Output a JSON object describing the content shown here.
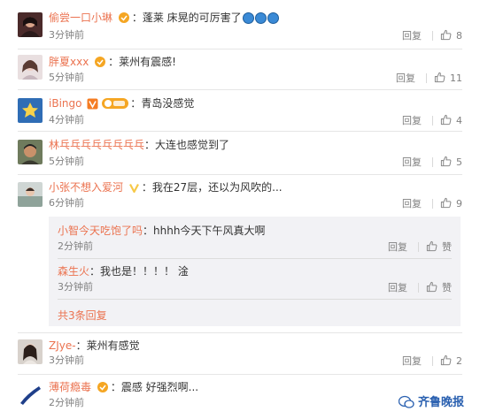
{
  "colors": {
    "username": "#eb7350",
    "text": "#333333",
    "muted": "#808080",
    "badge_orange": "#f5a623",
    "badge_yellow": "#f7c948"
  },
  "comments": [
    {
      "user": "偷尝一口小琳",
      "text": "蓬莱 床晃的可厉害了",
      "emoji_count": 3,
      "time": "3分钟前",
      "reply": "回复",
      "likes": "8"
    },
    {
      "user": "胖夏xxx",
      "text": "莱州有震感!",
      "time": "5分钟前",
      "reply": "回复",
      "likes": "11"
    },
    {
      "user": "iBingo",
      "text": "青岛没感觉",
      "time": "4分钟前",
      "reply": "回复",
      "likes": "4"
    },
    {
      "user": "林乓乓乓乓乓乓乓乓",
      "text": "大连也感觉到了",
      "time": "5分钟前",
      "reply": "回复",
      "likes": "5"
    },
    {
      "user": "小张不想入爱河",
      "text": "我在27层，还以为风吹的...",
      "time": "6分钟前",
      "reply": "回复",
      "likes": "9"
    },
    {
      "user": "ZJye-",
      "text": "莱州有感觉",
      "time": "3分钟前",
      "reply": "回复",
      "likes": "2"
    },
    {
      "user": "薄荷瘾毒",
      "text": "震感 好强烈啊...",
      "time": "2分钟前",
      "reply": "回复"
    }
  ],
  "replies": [
    {
      "user": "小智今天吃饱了吗",
      "text": "hhhh今天下午风真大啊",
      "time": "2分钟前",
      "reply": "回复",
      "like_label": "赞"
    },
    {
      "user": "森生火",
      "text": "我也是！！！！ 淦",
      "time": "3分钟前",
      "reply": "回复",
      "like_label": "赞"
    }
  ],
  "replies_total": "共3条回复",
  "watermark": "齐鲁晚报"
}
